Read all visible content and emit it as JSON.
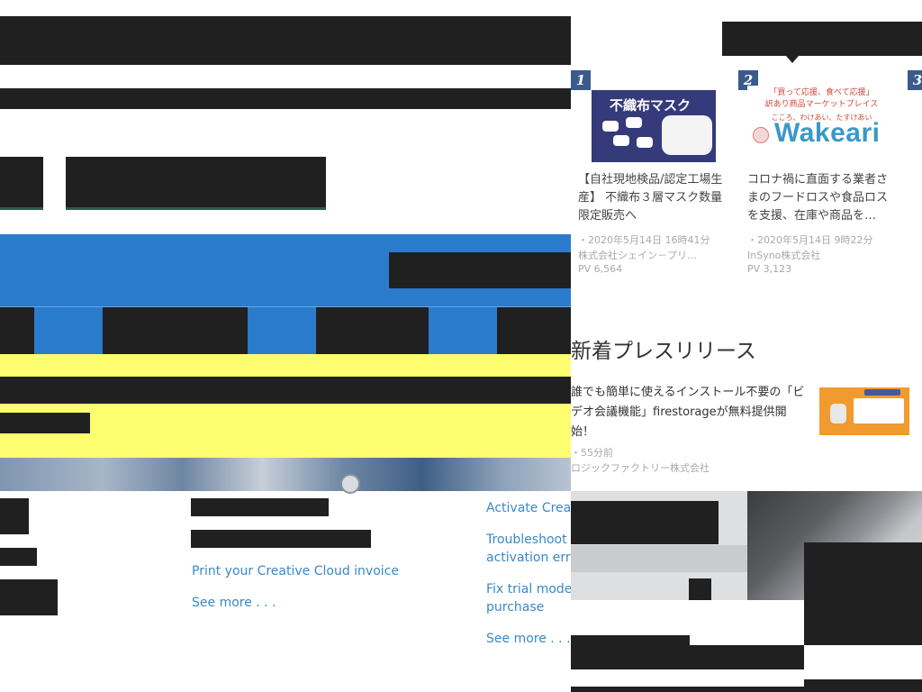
{
  "adobe_help": {
    "links_col2": [
      "Print your Creative Cloud invoice",
      "See more . . ."
    ],
    "links_col3": [
      "Activate Creati",
      "Troubleshoot C",
      "activation erro",
      "Fix trial mode",
      "purchase",
      "See more . . ."
    ]
  },
  "ranking": {
    "ranks": [
      "1",
      "2",
      "3"
    ],
    "cards": [
      {
        "thumb_title": "不織布マスク",
        "title": "【自社現地検品/認定工場生産】 不織布３層マスク数量限定販売へ",
        "date": "・2020年5月14日 16時41分",
        "company": "株式会社シェイン－プリ…",
        "pv": "PV 6,564"
      },
      {
        "thumb_top": "「買って応援、食べて応援」",
        "thumb_sub": "訳あり商品マーケットプレイス",
        "thumb_tag": "こころ、わけあい、たすけあい",
        "thumb_logo": "Wakeari",
        "title": "コロナ禍に直面する業者さまのフードロスや食品ロスを支援、在庫や商品を…",
        "date": "・2020年5月14日 9時22分",
        "company": "InSyno株式会社",
        "pv": "PV 3,123"
      }
    ]
  },
  "news": {
    "heading": "新着プレスリリース",
    "item": {
      "title": "誰でも簡単に使えるインストール不要の「ビデオ会議機能」firestorageが無料提供開始！",
      "time": "・55分前",
      "company": "ロジックファクトリー株式会社"
    }
  },
  "colors": {
    "blue_band": "#2b7bcc",
    "yellow_band": "#fdfd70",
    "link": "#3a88c8",
    "rank_badge": "#3a5a8c",
    "redaction": "#202020"
  }
}
